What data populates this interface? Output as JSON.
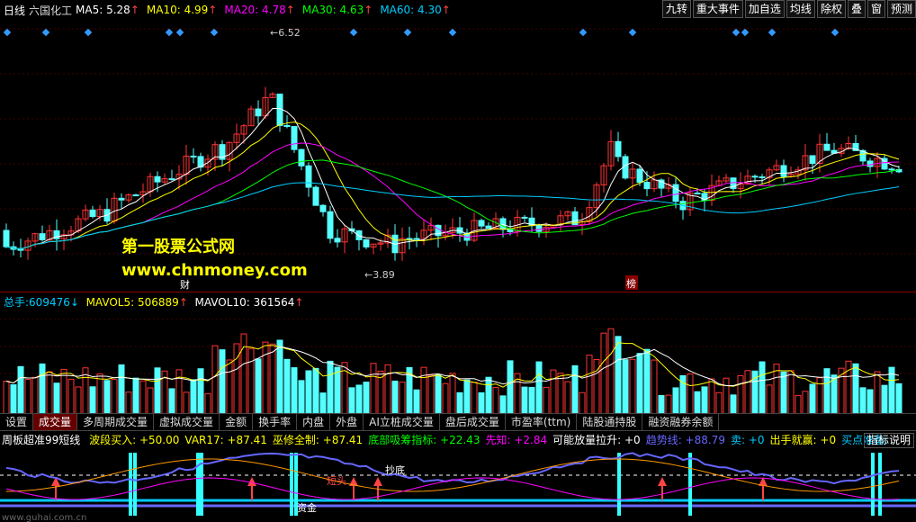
{
  "header": {
    "period": "日线",
    "stock": "六国化工",
    "ma": [
      {
        "label": "MA5:",
        "value": "5.28",
        "color": "#fff"
      },
      {
        "label": "MA10:",
        "value": "4.99",
        "color": "#ff0"
      },
      {
        "label": "MA20:",
        "value": "4.78",
        "color": "#f0f"
      },
      {
        "label": "MA30:",
        "value": "4.63",
        "color": "#0f0"
      },
      {
        "label": "MA60:",
        "value": "4.30",
        "color": "#0cf"
      }
    ],
    "buttons": [
      "九转",
      "重大事件",
      "加自选",
      "均线",
      "除权",
      "叠",
      "窗",
      "预测"
    ]
  },
  "kchart": {
    "high_label": "6.52",
    "low_label": "3.89",
    "marker1": "财",
    "marker2": "榜",
    "watermark1": "第一股票公式网",
    "watermark2": "www.chnmoney.com"
  },
  "volume": {
    "total_label": "总手:",
    "total": "609476",
    "mavol5_label": "MAVOL5:",
    "mavol5": "506889",
    "mavol10_label": "MAVOL10:",
    "mavol10": "361564"
  },
  "tabs": [
    "设置",
    "成交量",
    "多周期成交量",
    "虚拟成交量",
    "金额",
    "换手率",
    "内盘",
    "外盘",
    "AI立桩成交量",
    "盘后成交量",
    "市盈率(ttm)",
    "陆股通持股",
    "融资融券余额"
  ],
  "indicator": {
    "name": "周板超准99短线",
    "items": [
      {
        "text": "波段买入:",
        "value": "+50.00",
        "color": "#ff0"
      },
      {
        "text": "VAR17:",
        "value": "+87.41",
        "color": "#ff0"
      },
      {
        "text": "巫修全制:",
        "value": "+87.41",
        "color": "#ff0"
      },
      {
        "text": "底部吸筹指标:",
        "value": "+22.43",
        "color": "#0f0"
      },
      {
        "text": "先知:",
        "value": "+2.84",
        "color": "#f0f"
      },
      {
        "text": "可能放量拉升:",
        "value": "+0",
        "color": "#fff"
      },
      {
        "text": "趋势线:",
        "value": "+88.79",
        "color": "#66f"
      },
      {
        "text": "卖:",
        "value": "+0",
        "color": "#0cf"
      },
      {
        "text": "出手就赢:",
        "value": "+0",
        "color": "#ff0"
      },
      {
        "text": "买点准备:",
        "value": "",
        "color": "#0cf"
      }
    ],
    "help": "指标说明",
    "labels": {
      "short": "短头",
      "bottom": "抄底",
      "money": "资金"
    },
    "watermark": "www.guhai.com.cn"
  }
}
